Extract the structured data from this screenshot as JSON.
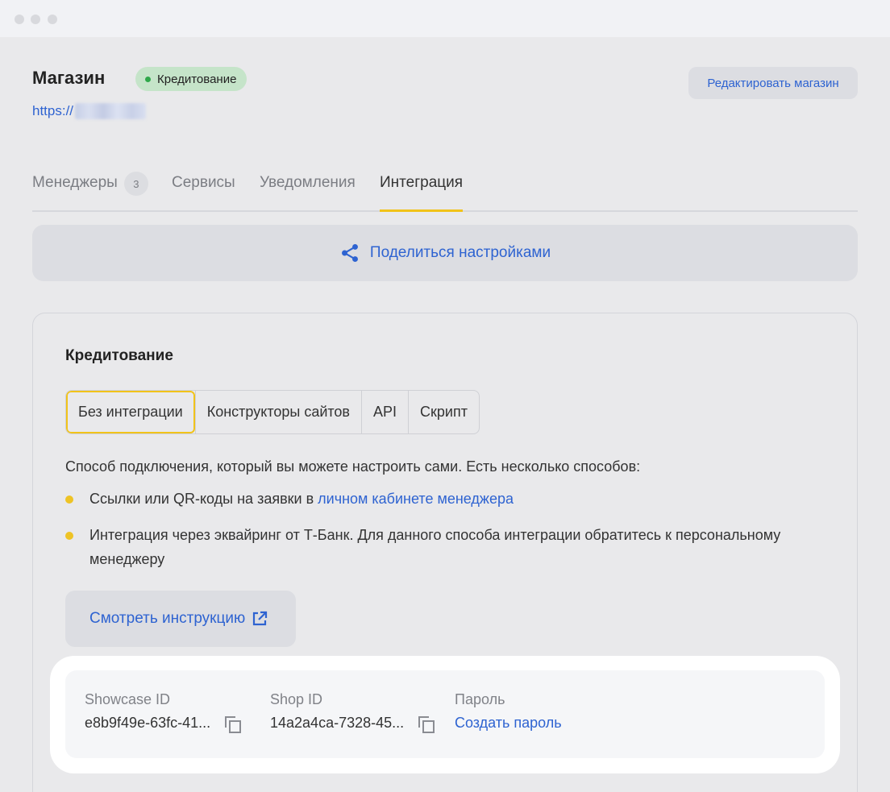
{
  "header": {
    "title": "Магазин",
    "status_badge": "Кредитование",
    "url_prefix": "https://",
    "edit_button": "Редактировать магазин"
  },
  "tabs": [
    {
      "label": "Менеджеры",
      "count": "3"
    },
    {
      "label": "Сервисы"
    },
    {
      "label": "Уведомления"
    },
    {
      "label": "Интеграция",
      "active": true
    }
  ],
  "share": {
    "label": "Поделиться настройками",
    "icon": "share-icon"
  },
  "card": {
    "title": "Кредитование",
    "segments": [
      {
        "label": "Без интеграции",
        "active": true
      },
      {
        "label": "Конструкторы сайтов"
      },
      {
        "label": "API"
      },
      {
        "label": "Скрипт"
      }
    ],
    "description": "Способ подключения, который вы можете настроить сами. Есть несколько способов:",
    "bullets": [
      {
        "text": "Ссылки или QR-коды на заявки в ",
        "link": "личном кабинете менеджера"
      },
      {
        "text": "Интеграция через эквайринг от Т-Банк. Для данного способа интеграции обратитесь к персональному менеджеру"
      }
    ],
    "instruction_button": "Смотреть инструкцию"
  },
  "ids": {
    "showcase": {
      "label": "Showcase ID",
      "value": "e8b9f49e-63fc-41..."
    },
    "shop": {
      "label": "Shop ID",
      "value": "14a2a4ca-7328-45..."
    },
    "password": {
      "label": "Пароль",
      "action": "Создать пароль"
    }
  },
  "colors": {
    "accent_blue": "#2e63d1",
    "accent_yellow": "#f1c31a",
    "status_green": "#2fa84a",
    "badge_bg": "#c5e4c9"
  }
}
